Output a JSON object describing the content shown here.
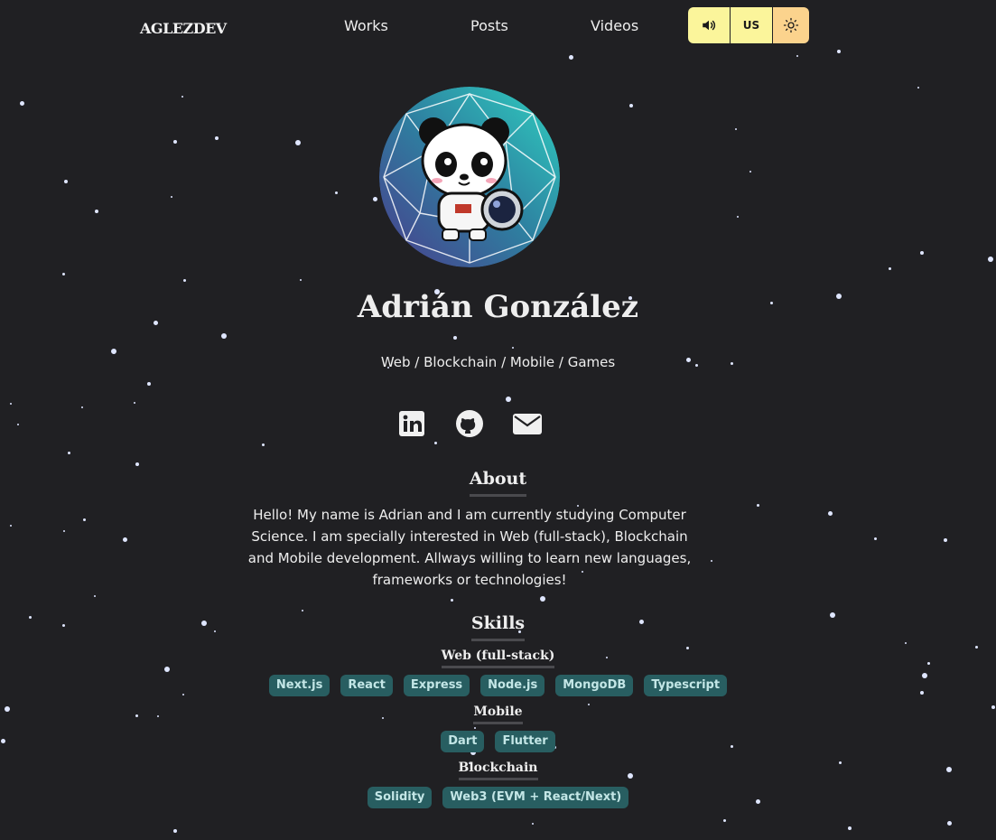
{
  "nav": {
    "logo": "AGLEZDEV",
    "links": [
      "Works",
      "Posts",
      "Videos"
    ],
    "lang": "US"
  },
  "profile": {
    "name": "Adrián González",
    "subtitle": "Web / Blockchain / Mobile / Games"
  },
  "about": {
    "title": "About",
    "text": "Hello! My name is Adrian and I am currently studying Computer Science. I am specially interested in Web (full-stack), Blockchain and Mobile development. Allways willing to learn new languages, frameworks or technologies!"
  },
  "skills": {
    "title": "Skills",
    "groups": [
      {
        "title": "Web (full-stack)",
        "tags": [
          "Next.js",
          "React",
          "Express",
          "Node.js",
          "MongoDB",
          "Typescript"
        ]
      },
      {
        "title": "Mobile",
        "tags": [
          "Dart",
          "Flutter"
        ]
      },
      {
        "title": "Blockchain",
        "tags": [
          "Solidity",
          "Web3 (EVM + React/Next)"
        ]
      }
    ]
  },
  "colors": {
    "background": "#202023",
    "tag_bg": "#285e61",
    "tag_text": "#c3e6e6",
    "sound_button": "#fbf59b",
    "theme_button": "#fbd38d"
  },
  "icons": [
    "speaker-icon",
    "sun-icon",
    "linkedin-icon",
    "github-icon",
    "mail-icon",
    "avatar-panda"
  ]
}
